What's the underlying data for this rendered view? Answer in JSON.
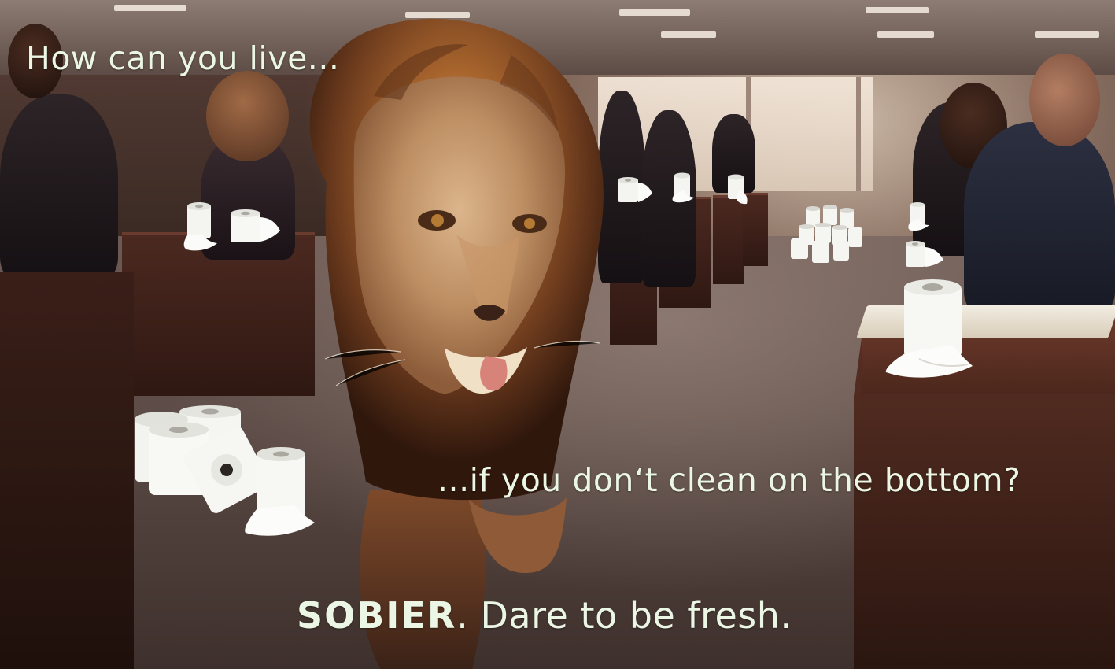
{
  "headline": {
    "top_text": "How can you live...",
    "middle_text": "...if you don‘t clean on the bottom?"
  },
  "tagline": {
    "brand": "SOBIER",
    "rest": ". Dare to be fresh."
  },
  "colors": {
    "text": "#ebf6e5",
    "lion_mane": "#6b3a1d",
    "office_shadow": "#2f1812"
  },
  "objects": {
    "main_subject": "lion-icon",
    "repeated_props": "toilet-roll-icon"
  }
}
